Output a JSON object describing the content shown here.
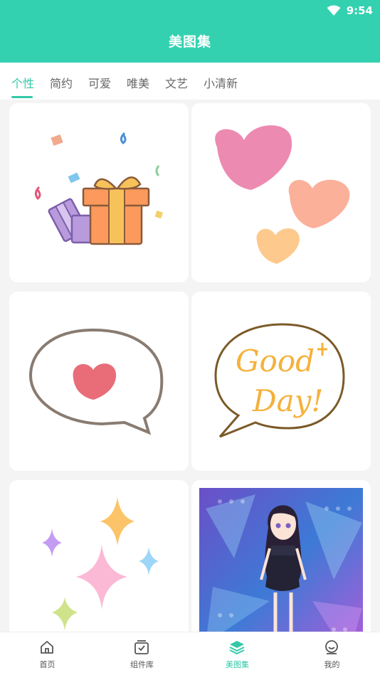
{
  "status": {
    "time": "9:54",
    "wifi_icon": "wifi-icon"
  },
  "header": {
    "title": "美图集"
  },
  "tabs": [
    {
      "label": "个性",
      "active": true
    },
    {
      "label": "简约",
      "active": false
    },
    {
      "label": "可爱",
      "active": false
    },
    {
      "label": "唯美",
      "active": false
    },
    {
      "label": "文艺",
      "active": false
    },
    {
      "label": "小清新",
      "active": false
    }
  ],
  "cards": {
    "gift": {
      "name": "gift-box-sticker"
    },
    "hearts": {
      "name": "three-hearts-sticker"
    },
    "bubble_heart": {
      "name": "heart-speech-bubble-sticker"
    },
    "good_day": {
      "name": "good-day-bubble-sticker",
      "text_line1": "Good",
      "text_line2": "Day!"
    },
    "sparkles": {
      "name": "sparkles-sticker"
    },
    "doll": {
      "name": "anime-doll-wallpaper"
    }
  },
  "nav": [
    {
      "label": "首页",
      "icon": "home-icon",
      "active": false
    },
    {
      "label": "组件库",
      "icon": "widget-library-icon",
      "active": false
    },
    {
      "label": "美图集",
      "icon": "layers-icon",
      "active": true
    },
    {
      "label": "我的",
      "icon": "profile-icon",
      "active": false
    }
  ],
  "colors": {
    "accent": "#33d1b0",
    "tab_active": "#33c9a8",
    "background": "#f4f4f4"
  }
}
